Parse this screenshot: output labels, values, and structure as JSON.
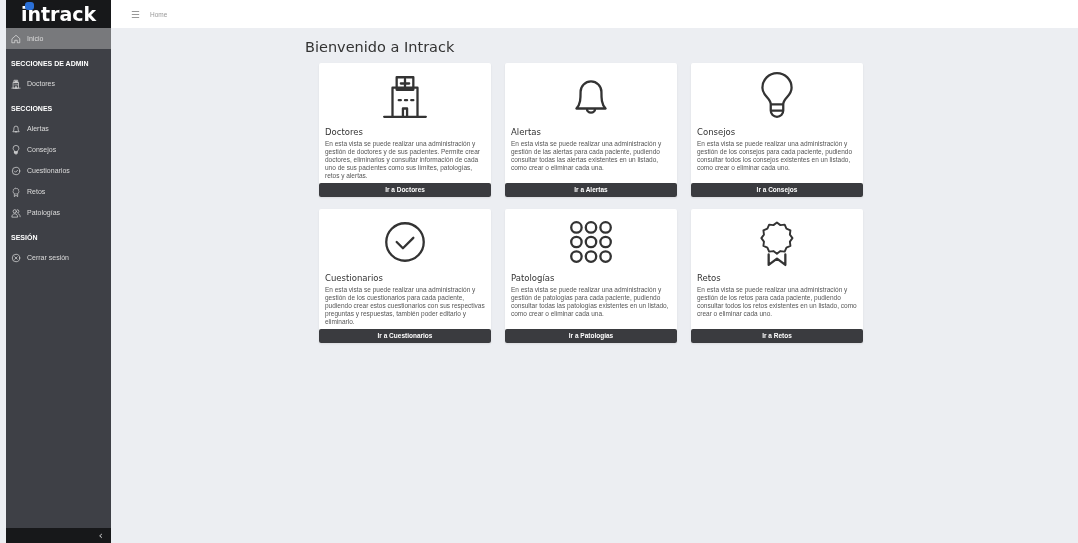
{
  "logo": "intrack",
  "menu": "☰",
  "breadcrumb": "Home",
  "sidebar": {
    "groups": [
      {
        "items": [
          {
            "label": "Inicio",
            "selected": true
          }
        ]
      },
      {
        "heading": "SECCIONES DE ADMIN",
        "items": [
          {
            "label": "Doctores",
            "selected": false
          }
        ]
      },
      {
        "heading": "SECCIONES",
        "items": [
          {
            "label": "Alertas",
            "selected": false
          },
          {
            "label": "Consejos",
            "selected": false
          },
          {
            "label": "Cuestionarios",
            "selected": false
          },
          {
            "label": "Retos",
            "selected": false
          },
          {
            "label": "Patologías",
            "selected": false
          }
        ]
      },
      {
        "heading": "SESIÓN",
        "items": [
          {
            "label": "Cerrar sesión",
            "selected": false
          }
        ]
      }
    ],
    "collapse": "‹"
  },
  "page_title": "Bienvenido a Intrack",
  "cards": [
    {
      "title": "Doctores",
      "text": "En esta vista se puede realizar una administración y gestión de doctores y de sus pacientes. Permite crear doctores, eliminarlos y consultar información de cada uno de sus pacientes como sus límites, patologías, retos y alertas.",
      "button": "Ir a Doctores"
    },
    {
      "title": "Alertas",
      "text": "En esta vista se puede realizar una administración y gestión de las alertas para cada paciente, pudiendo consultar todas las alertas existentes en un listado, como crear o eliminar cada una.",
      "button": "Ir a Alertas"
    },
    {
      "title": "Consejos",
      "text": "En esta vista se puede realizar una administración y gestión de los consejos para cada paciente, pudiendo consultar todos los consejos existentes en un listado, como crear o eliminar cada uno.",
      "button": "Ir a Consejos"
    },
    {
      "title": "Cuestionarios",
      "text": "En esta vista se puede realizar una administración y gestión de los cuestionarios para cada paciente, pudiendo crear estos cuestionarios con sus respectivas preguntas y respuestas, también poder editarlo y eliminarlo.",
      "button": "Ir a Cuestionarios"
    },
    {
      "title": "Patologías",
      "text": "En esta vista se puede realizar una administración y gestión de patologías para cada paciente, pudiendo consultar todas las patologías existentes en un listado, como crear o eliminar cada una.",
      "button": "Ir a Patologías"
    },
    {
      "title": "Retos",
      "text": "En esta vista se puede realizar una administración y gestión de los retos para cada paciente, pudiendo consultar todos los retos existentes en un listado, como crear o eliminar cada uno.",
      "button": "Ir a Retos"
    }
  ]
}
